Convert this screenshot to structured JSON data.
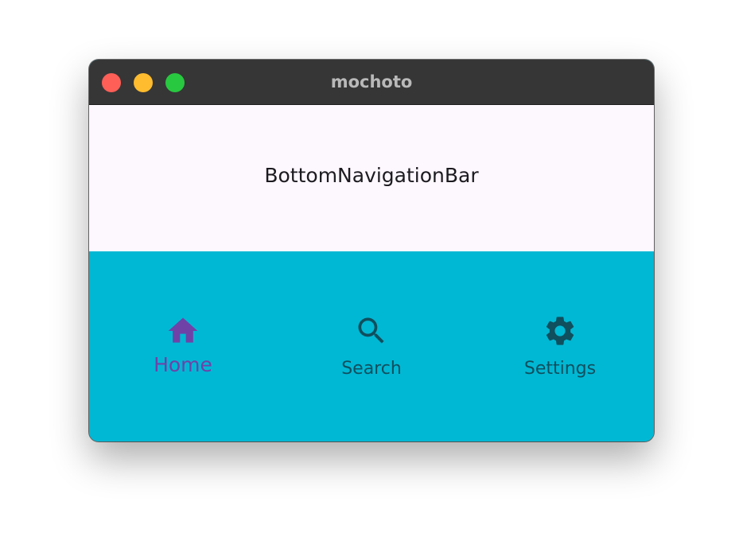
{
  "window": {
    "title": "mochoto"
  },
  "body": {
    "text": "BottomNavigationBar"
  },
  "bottom_nav": {
    "items": [
      {
        "label": "Home",
        "icon": "home-icon",
        "selected": true
      },
      {
        "label": "Search",
        "icon": "search-icon",
        "selected": false
      },
      {
        "label": "Settings",
        "icon": "settings-icon",
        "selected": false
      }
    ]
  },
  "colors": {
    "nav_background": "#00b8d4",
    "selected": "#6f42a8",
    "unselected": "#0f4f5e",
    "body_background": "#fdf7fe",
    "titlebar": "#363636"
  }
}
